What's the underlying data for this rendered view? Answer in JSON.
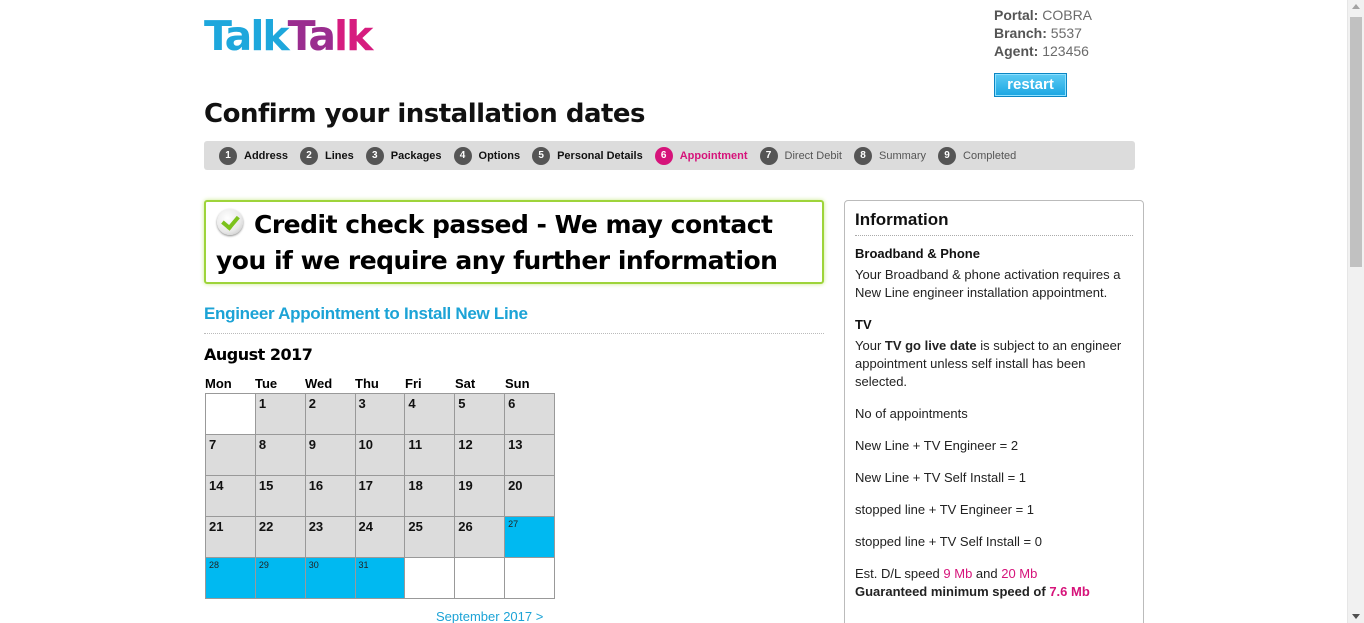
{
  "logo": {
    "part1": "Talk",
    "part2": "Ta",
    "part3": "lk"
  },
  "agent": {
    "portal_label": "Portal:",
    "portal_value": "COBRA",
    "branch_label": "Branch:",
    "branch_value": "5537",
    "agent_label": "Agent:",
    "agent_value": "123456",
    "restart_label": "restart"
  },
  "page_title": "Confirm your installation dates",
  "steps": [
    {
      "num": "1",
      "label": "Address",
      "state": "done"
    },
    {
      "num": "2",
      "label": "Lines",
      "state": "done"
    },
    {
      "num": "3",
      "label": "Packages",
      "state": "done"
    },
    {
      "num": "4",
      "label": "Options",
      "state": "done"
    },
    {
      "num": "5",
      "label": "Personal Details",
      "state": "done"
    },
    {
      "num": "6",
      "label": "Appointment",
      "state": "active"
    },
    {
      "num": "7",
      "label": "Direct Debit",
      "state": "todo"
    },
    {
      "num": "8",
      "label": "Summary",
      "state": "todo"
    },
    {
      "num": "9",
      "label": "Completed",
      "state": "todo"
    }
  ],
  "credit": {
    "message": "Credit check passed - We may contact you if we require any further information"
  },
  "engineer": {
    "title": "Engineer Appointment to Install New Line"
  },
  "calendar": {
    "month": "August 2017",
    "weekdays": [
      "Mon",
      "Tue",
      "Wed",
      "Thu",
      "Fri",
      "Sat",
      "Sun"
    ],
    "weeks": [
      [
        {
          "d": "",
          "s": "empty"
        },
        {
          "d": "1",
          "s": "na"
        },
        {
          "d": "2",
          "s": "na"
        },
        {
          "d": "3",
          "s": "na"
        },
        {
          "d": "4",
          "s": "na"
        },
        {
          "d": "5",
          "s": "na"
        },
        {
          "d": "6",
          "s": "na"
        }
      ],
      [
        {
          "d": "7",
          "s": "na"
        },
        {
          "d": "8",
          "s": "na"
        },
        {
          "d": "9",
          "s": "na"
        },
        {
          "d": "10",
          "s": "na"
        },
        {
          "d": "11",
          "s": "na"
        },
        {
          "d": "12",
          "s": "na"
        },
        {
          "d": "13",
          "s": "na"
        }
      ],
      [
        {
          "d": "14",
          "s": "na"
        },
        {
          "d": "15",
          "s": "na"
        },
        {
          "d": "16",
          "s": "na"
        },
        {
          "d": "17",
          "s": "na"
        },
        {
          "d": "18",
          "s": "na"
        },
        {
          "d": "19",
          "s": "na"
        },
        {
          "d": "20",
          "s": "na"
        }
      ],
      [
        {
          "d": "21",
          "s": "na"
        },
        {
          "d": "22",
          "s": "na"
        },
        {
          "d": "23",
          "s": "na"
        },
        {
          "d": "24",
          "s": "na"
        },
        {
          "d": "25",
          "s": "na"
        },
        {
          "d": "26",
          "s": "na"
        },
        {
          "d": "27",
          "s": "avail"
        }
      ],
      [
        {
          "d": "28",
          "s": "avail"
        },
        {
          "d": "29",
          "s": "avail"
        },
        {
          "d": "30",
          "s": "avail"
        },
        {
          "d": "31",
          "s": "avail"
        },
        {
          "d": "",
          "s": "empty"
        },
        {
          "d": "",
          "s": "empty"
        },
        {
          "d": "",
          "s": "empty"
        }
      ]
    ],
    "next_link": "September 2017 >"
  },
  "info": {
    "title": "Information",
    "bb_heading": "Broadband & Phone",
    "bb_text": "Your Broadband & phone activation requires a New Line engineer installation appointment.",
    "tv_heading": "TV",
    "tv_text_pre": "Your ",
    "tv_text_bold": "TV go live date",
    "tv_text_post": " is subject to an engineer appointment unless self install has been selected.",
    "appts_label": "No of appointments",
    "appt1": "New Line + TV Engineer = 2",
    "appt2": "New Line + TV Self Install = 1",
    "appt3": "stopped line + TV Engineer = 1",
    "appt4": "stopped line + TV Self Install = 0",
    "speed_pre": "Est. D/L speed ",
    "speed_low": "9 Mb",
    "speed_and": " and ",
    "speed_high": "20 Mb",
    "guaranteed_pre": "Guaranteed minimum speed of ",
    "guaranteed_value": "7.6 Mb"
  },
  "colors": {
    "brand_blue": "#1ca3d6",
    "brand_pink": "#d6137a",
    "available_day": "#00b9f1",
    "success_green": "#9ed43a"
  }
}
